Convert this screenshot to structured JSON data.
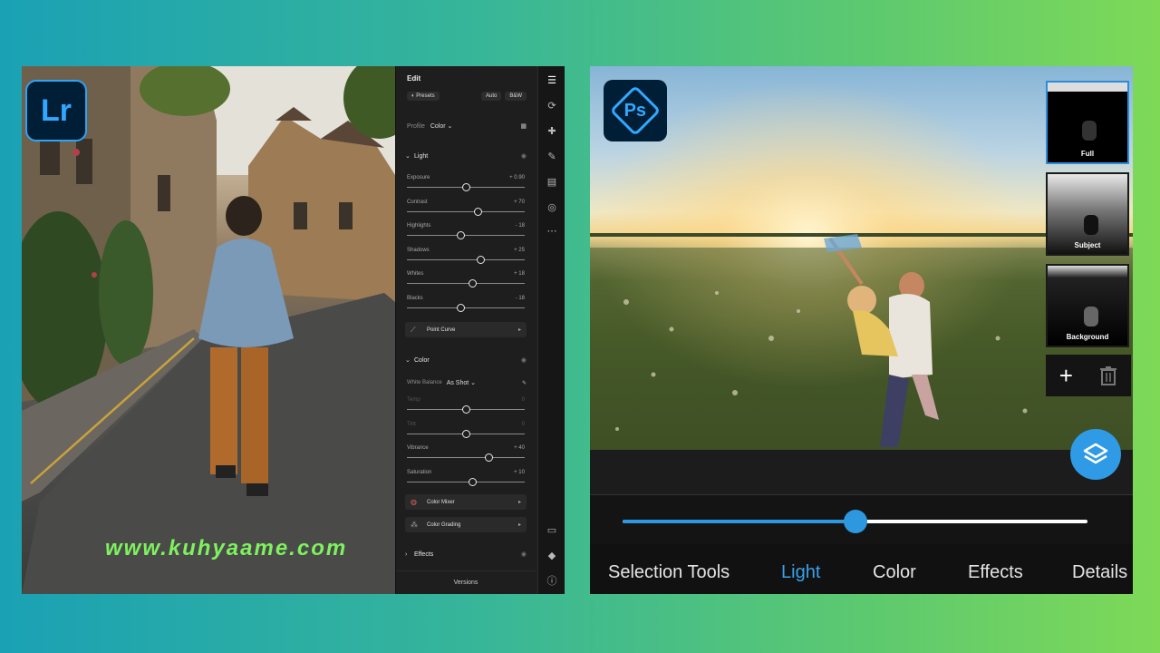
{
  "lightroom": {
    "badge": "Lr",
    "watermark": "www.kuhyaame.com",
    "panel": {
      "title": "Edit",
      "presets_label": "Presets",
      "auto_label": "Auto",
      "bw_label": "B&W",
      "profile_label": "Profile",
      "profile_value": "Color",
      "light": {
        "title": "Light",
        "sliders": [
          {
            "label": "Exposure",
            "value": "+ 0.90",
            "pos": 0.5
          },
          {
            "label": "Contrast",
            "value": "+ 70",
            "pos": 0.6
          },
          {
            "label": "Highlights",
            "value": "- 18",
            "pos": 0.45
          },
          {
            "label": "Shadows",
            "value": "+ 25",
            "pos": 0.62
          },
          {
            "label": "Whites",
            "value": "+ 18",
            "pos": 0.55
          },
          {
            "label": "Blacks",
            "value": "- 18",
            "pos": 0.45
          }
        ]
      },
      "point_curve_label": "Point Curve",
      "color": {
        "title": "Color",
        "white_balance_label": "White Balance",
        "white_balance_value": "As Shot",
        "sliders": [
          {
            "label": "Temp",
            "value": "0",
            "pos": 0.5,
            "dim": true
          },
          {
            "label": "Tint",
            "value": "0",
            "pos": 0.5,
            "dim": true
          },
          {
            "label": "Vibrance",
            "value": "+ 40",
            "pos": 0.69
          },
          {
            "label": "Saturation",
            "value": "+ 10",
            "pos": 0.55
          }
        ]
      },
      "color_mixer_label": "Color Mixer",
      "color_grading_label": "Color Grading",
      "effects_label": "Effects",
      "versions_label": "Versions"
    },
    "tool_icons": [
      "edit-sliders-icon",
      "crop-icon",
      "heal-icon",
      "brush-icon",
      "gradient-icon",
      "radial-icon",
      "more-icon",
      "comment-icon",
      "tag-icon",
      "info-icon"
    ]
  },
  "photoshop": {
    "badge": "Ps",
    "layers": [
      {
        "label": "Full",
        "selected": true
      },
      {
        "label": "Subject",
        "selected": false
      },
      {
        "label": "Background",
        "selected": false
      }
    ],
    "add_label": "+",
    "slider_value": 0.5,
    "tabs": [
      "Selection Tools",
      "Light",
      "Color",
      "Effects",
      "Details"
    ],
    "active_tab": "Light"
  }
}
